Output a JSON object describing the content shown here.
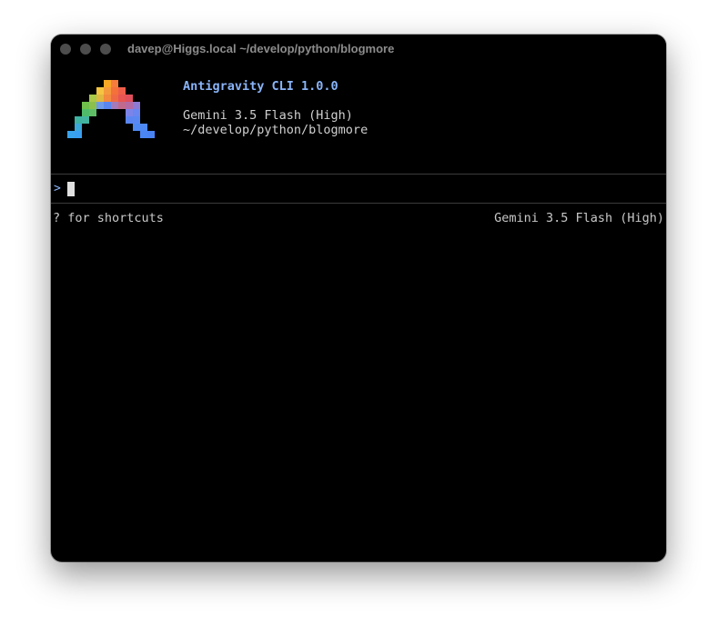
{
  "window": {
    "title": "davep@Higgs.local ~/develop/python/blogmore"
  },
  "banner": {
    "app_name": "Antigravity CLI 1.0.0",
    "model": "Gemini 3.5 Flash (High)",
    "cwd": "~/develop/python/blogmore",
    "logo_icon": "antigravity-logo-icon"
  },
  "prompt": {
    "symbol": ">",
    "value": "",
    "placeholder": ""
  },
  "footer": {
    "hint": "? for shortcuts",
    "model": "Gemini 3.5 Flash (High)"
  },
  "colors": {
    "background": "#000000",
    "accent": "#8ab4f8",
    "text": "#d0d0d0",
    "divider": "#3c3c3c"
  }
}
